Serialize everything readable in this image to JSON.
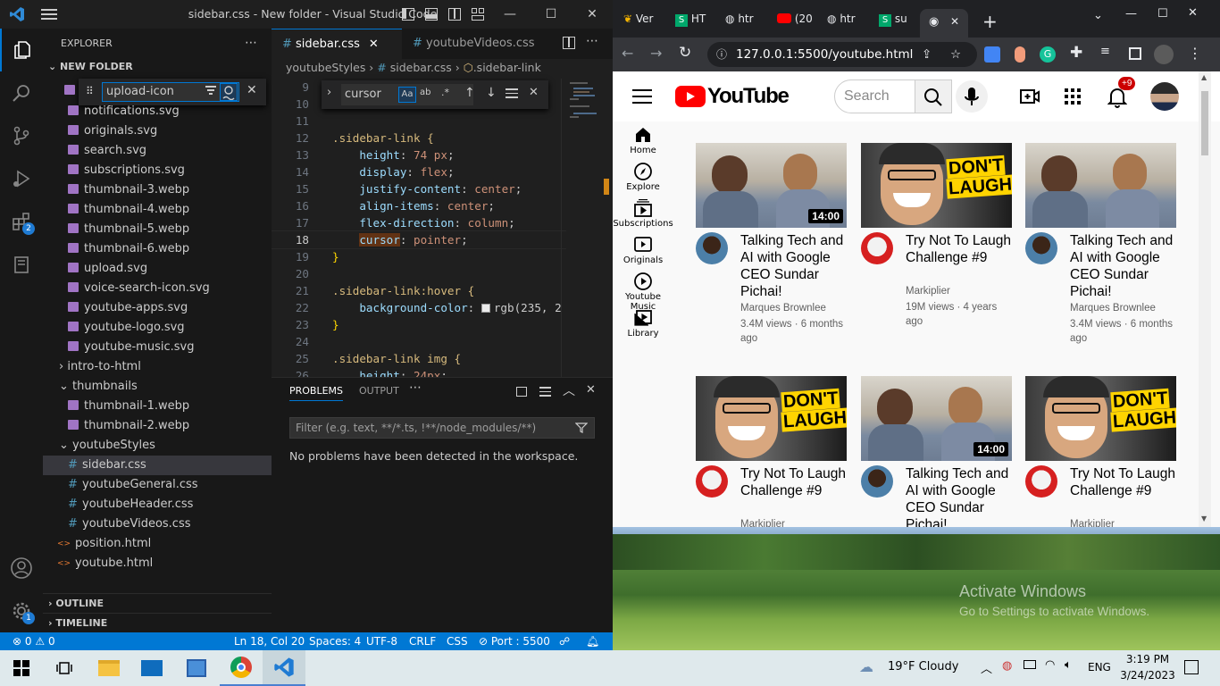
{
  "vscode": {
    "title": "sidebar.css - New folder - Visual Studio Code",
    "explorer_label": "EXPLORER",
    "folder_name": "NEW FOLDER",
    "find_value": "upload-icon",
    "badges": {
      "extensions": "2",
      "settings": "1"
    },
    "files": [
      "notifications.svg",
      "originals.svg",
      "search.svg",
      "subscriptions.svg",
      "thumbnail-3.webp",
      "thumbnail-4.webp",
      "thumbnail-5.webp",
      "thumbnail-6.webp",
      "upload.svg",
      "voice-search-icon.svg",
      "youtube-apps.svg",
      "youtube-logo.svg",
      "youtube-music.svg"
    ],
    "folder_intro": "intro-to-html",
    "folder_thumbnails": "thumbnails",
    "thumbnails_files": [
      "thumbnail-1.webp",
      "thumbnail-2.webp"
    ],
    "folder_styles": "youtubeStyles",
    "styles_files": [
      "sidebar.css",
      "youtubeGeneral.css",
      "youtubeHeader.css",
      "youtubeVideos.css"
    ],
    "root_files": [
      "position.html",
      "youtube.html"
    ],
    "outline": "OUTLINE",
    "timeline": "TIMELINE",
    "tabs": [
      "sidebar.css",
      "youtubeVideos.css"
    ],
    "breadcrumb": [
      "youtubeStyles",
      "sidebar.css",
      ".sidebar-link"
    ],
    "editor_find_value": "cursor",
    "line_numbers": [
      "9",
      "10",
      "11",
      "12",
      "13",
      "14",
      "15",
      "16",
      "17",
      "18",
      "19",
      "20",
      "21",
      "22",
      "23",
      "24",
      "25",
      "26"
    ],
    "code": {
      "l12": ".sidebar-link {",
      "l13p": "height",
      "l13v": "74 px",
      "l14p": "display",
      "l14v": "flex",
      "l15p": "justify-content",
      "l15v": "center",
      "l16p": "align-items",
      "l16v": "center",
      "l17p": "flex-direction",
      "l17v": "column",
      "l18p": "cursor",
      "l18v": "pointer",
      "l19": "}",
      "l21": ".sidebar-link:hover {",
      "l22p": "background-color",
      "l22v": "rgb(235, 2",
      "l23": "}",
      "l25": ".sidebar-link img {",
      "l26p": "height",
      "l26v": "24px"
    },
    "panel": {
      "tab_problems": "PROBLEMS",
      "tab_output": "OUTPUT",
      "filter_placeholder": "Filter (e.g. text, **/*.ts, !**/node_modules/**)",
      "message": "No problems have been detected in the workspace."
    },
    "status": {
      "errors": "0",
      "warnings": "0",
      "position": "Ln 18, Col 20",
      "spaces": "Spaces: 4",
      "encoding": "UTF-8",
      "eol": "CRLF",
      "language": "CSS",
      "port": "Port : 5500"
    }
  },
  "chrome": {
    "tabs": [
      "Ver",
      "HT",
      "htr",
      "(20",
      "htr",
      "su"
    ],
    "url": "127.0.0.1:5500/youtube.html",
    "youtube": {
      "logo_text": "YouTube",
      "search_placeholder": "Search",
      "notif_count": "+9",
      "sidebar": [
        "Home",
        "Explore",
        "Subscriptions",
        "Originals",
        "Youtube Music",
        "Library"
      ],
      "videos": [
        {
          "duration": "14:00",
          "title": "Talking Tech and AI with Google CEO Sundar Pichai!",
          "channel": "Marques Brownlee",
          "stats": "3.4M views · 6 months ago",
          "kind": "mkbhd"
        },
        {
          "duration": "",
          "title": "Try Not To Laugh Challenge #9",
          "channel": "Markiplier",
          "stats": "19M views · 4 years ago",
          "kind": "mark"
        },
        {
          "duration": "",
          "title": "Talking Tech and AI with Google CEO Sundar Pichai!",
          "channel": "Marques Brownlee",
          "stats": "3.4M views · 6 months ago",
          "kind": "mkbhd"
        },
        {
          "duration": "",
          "title": "Try Not To Laugh Challenge #9",
          "channel": "Markiplier",
          "stats": "",
          "kind": "mark"
        },
        {
          "duration": "14:00",
          "title": "Talking Tech and AI with Google CEO Sundar Pichai!",
          "channel": "",
          "stats": "",
          "kind": "mkbhd"
        },
        {
          "duration": "",
          "title": "Try Not To Laugh Challenge #9",
          "channel": "Markiplier",
          "stats": "",
          "kind": "mark"
        }
      ],
      "dont_laugh_1": "DON'T",
      "dont_laugh_2": "LAUGH"
    }
  },
  "desktop": {
    "activate_title": "Activate Windows",
    "activate_sub": "Go to Settings to activate Windows."
  },
  "taskbar": {
    "weather": "19°F  Cloudy",
    "lang": "ENG",
    "time": "3:19 PM",
    "date": "3/24/2023"
  },
  "colors": {
    "vscode_accent": "#0078d4",
    "youtube_red": "#ff0000",
    "chrome_dark": "#202124"
  }
}
